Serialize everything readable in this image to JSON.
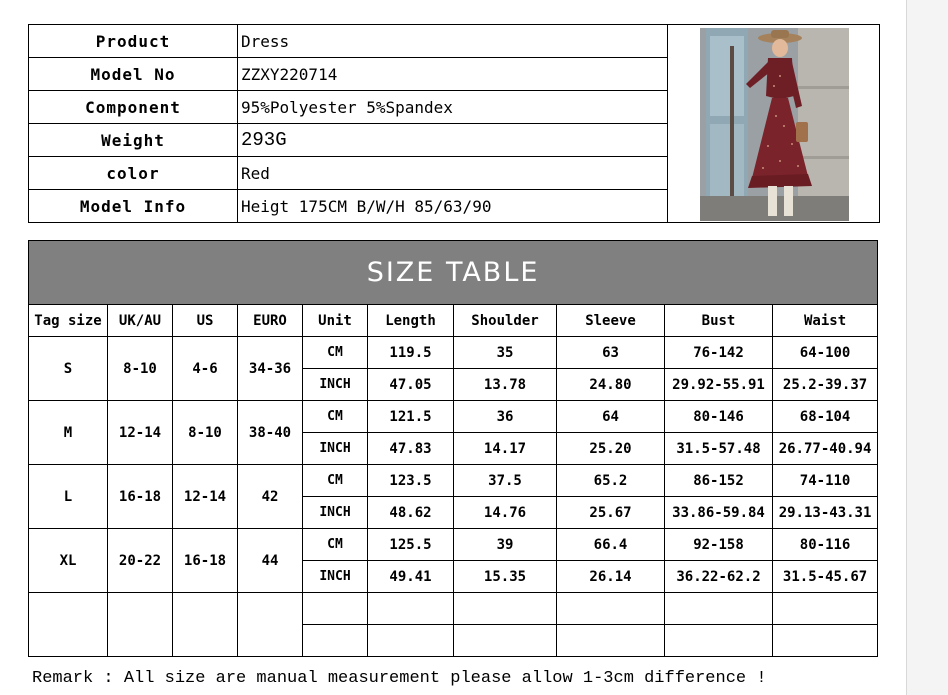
{
  "info": {
    "rows": [
      {
        "label": "Product",
        "value": "Dress"
      },
      {
        "label": "Model No",
        "value": "ZZXY220714"
      },
      {
        "label": "Component",
        "value": "95%Polyester 5%Spandex"
      },
      {
        "label": "Weight",
        "value": "293G"
      },
      {
        "label": "color",
        "value": "Red"
      },
      {
        "label": "Model Info",
        "value": "Heigt 175CM B/W/H 85/63/90"
      }
    ]
  },
  "size_table": {
    "title": "SIZE TABLE",
    "headers": [
      "Tag size",
      "UK/AU",
      "US",
      "EURO",
      "Unit",
      "Length",
      "Shoulder",
      "Sleeve",
      "Bust",
      "Waist"
    ],
    "sizes": [
      {
        "tag": "S",
        "uk": "8-10",
        "us": "4-6",
        "euro": "34-36",
        "cm": {
          "unit": "CM",
          "length": "119.5",
          "shoulder": "35",
          "sleeve": "63",
          "bust": "76-142",
          "waist": "64-100"
        },
        "inch": {
          "unit": "INCH",
          "length": "47.05",
          "shoulder": "13.78",
          "sleeve": "24.80",
          "bust": "29.92-55.91",
          "waist": "25.2-39.37"
        }
      },
      {
        "tag": "M",
        "uk": "12-14",
        "us": "8-10",
        "euro": "38-40",
        "cm": {
          "unit": "CM",
          "length": "121.5",
          "shoulder": "36",
          "sleeve": "64",
          "bust": "80-146",
          "waist": "68-104"
        },
        "inch": {
          "unit": "INCH",
          "length": "47.83",
          "shoulder": "14.17",
          "sleeve": "25.20",
          "bust": "31.5-57.48",
          "waist": "26.77-40.94"
        }
      },
      {
        "tag": "L",
        "uk": "16-18",
        "us": "12-14",
        "euro": "42",
        "cm": {
          "unit": "CM",
          "length": "123.5",
          "shoulder": "37.5",
          "sleeve": "65.2",
          "bust": "86-152",
          "waist": "74-110"
        },
        "inch": {
          "unit": "INCH",
          "length": "48.62",
          "shoulder": "14.76",
          "sleeve": "25.67",
          "bust": "33.86-59.84",
          "waist": "29.13-43.31"
        }
      },
      {
        "tag": "XL",
        "uk": "20-22",
        "us": "16-18",
        "euro": "44",
        "cm": {
          "unit": "CM",
          "length": "125.5",
          "shoulder": "39",
          "sleeve": "66.4",
          "bust": "92-158",
          "waist": "80-116"
        },
        "inch": {
          "unit": "INCH",
          "length": "49.41",
          "shoulder": "15.35",
          "sleeve": "26.14",
          "bust": "36.22-62.2",
          "waist": "31.5-45.67"
        }
      }
    ]
  },
  "remark": "Remark : All size are manual measurement please allow 1-3cm difference !"
}
